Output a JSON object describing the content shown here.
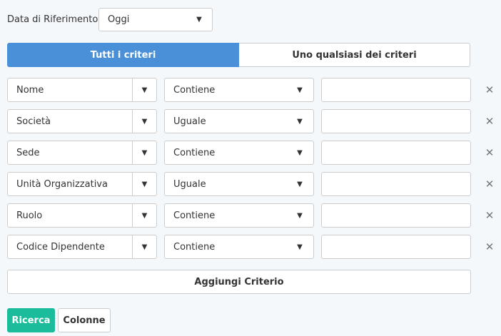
{
  "reference": {
    "label": "Data di Riferimento",
    "value": "Oggi"
  },
  "match_mode": {
    "all_label": "Tutti i criteri",
    "any_label": "Uno qualsiasi dei criteri",
    "selected": "all"
  },
  "criteria": [
    {
      "field": "Nome",
      "operator": "Contiene",
      "value": ""
    },
    {
      "field": "Società",
      "operator": "Uguale",
      "value": ""
    },
    {
      "field": "Sede",
      "operator": "Contiene",
      "value": ""
    },
    {
      "field": "Unità Organizzativa",
      "operator": "Uguale",
      "value": ""
    },
    {
      "field": "Ruolo",
      "operator": "Contiene",
      "value": ""
    },
    {
      "field": "Codice Dipendente",
      "operator": "Contiene",
      "value": ""
    }
  ],
  "icons": {
    "caret": "▼",
    "remove": "✕"
  },
  "actions": {
    "add_criterion": "Aggiungi Criterio",
    "search": "Ricerca",
    "columns": "Colonne"
  },
  "colors": {
    "accent": "#4a90d9",
    "search": "#1abc9c"
  }
}
